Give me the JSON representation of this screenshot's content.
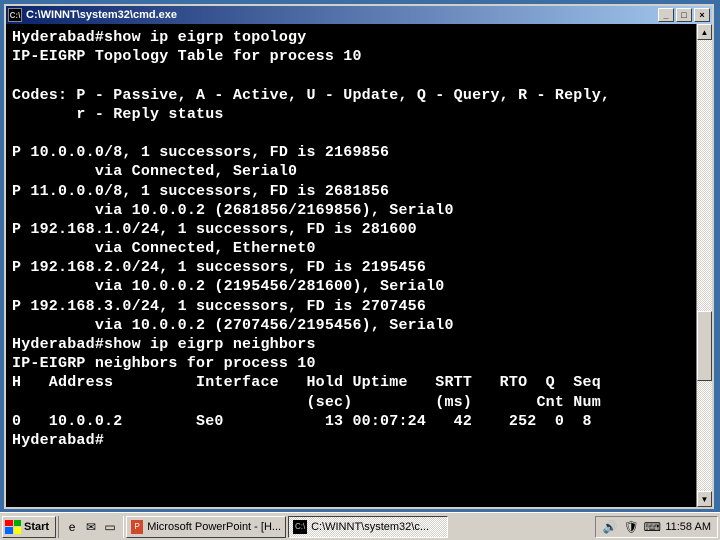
{
  "window": {
    "title": "C:\\WINNT\\system32\\cmd.exe",
    "sys_icon": "C:\\"
  },
  "win_buttons": {
    "minimize": "_",
    "maximize": "□",
    "close": "×"
  },
  "terminal_lines": [
    "Hyderabad#show ip eigrp topology",
    "IP-EIGRP Topology Table for process 10",
    "",
    "Codes: P - Passive, A - Active, U - Update, Q - Query, R - Reply,",
    "       r - Reply status",
    "",
    "P 10.0.0.0/8, 1 successors, FD is 2169856",
    "         via Connected, Serial0",
    "P 11.0.0.0/8, 1 successors, FD is 2681856",
    "         via 10.0.0.2 (2681856/2169856), Serial0",
    "P 192.168.1.0/24, 1 successors, FD is 281600",
    "         via Connected, Ethernet0",
    "P 192.168.2.0/24, 1 successors, FD is 2195456",
    "         via 10.0.0.2 (2195456/281600), Serial0",
    "P 192.168.3.0/24, 1 successors, FD is 2707456",
    "         via 10.0.0.2 (2707456/2195456), Serial0",
    "Hyderabad#show ip eigrp neighbors",
    "IP-EIGRP neighbors for process 10",
    "H   Address         Interface   Hold Uptime   SRTT   RTO  Q  Seq",
    "                                (sec)         (ms)       Cnt Num",
    "0   10.0.0.2        Se0           13 00:07:24   42    252  0  8",
    "Hyderabad#"
  ],
  "scrollbar": {
    "up": "▲",
    "down": "▼"
  },
  "taskbar": {
    "start": "Start",
    "tasks": [
      {
        "icon": "P",
        "label": "Microsoft PowerPoint - [H..."
      },
      {
        "icon": "C:\\",
        "label": "C:\\WINNT\\system32\\c..."
      }
    ],
    "systray": {
      "icons": [
        "🔊",
        "🛡",
        "⌨"
      ],
      "clock": "11:58 AM"
    }
  }
}
